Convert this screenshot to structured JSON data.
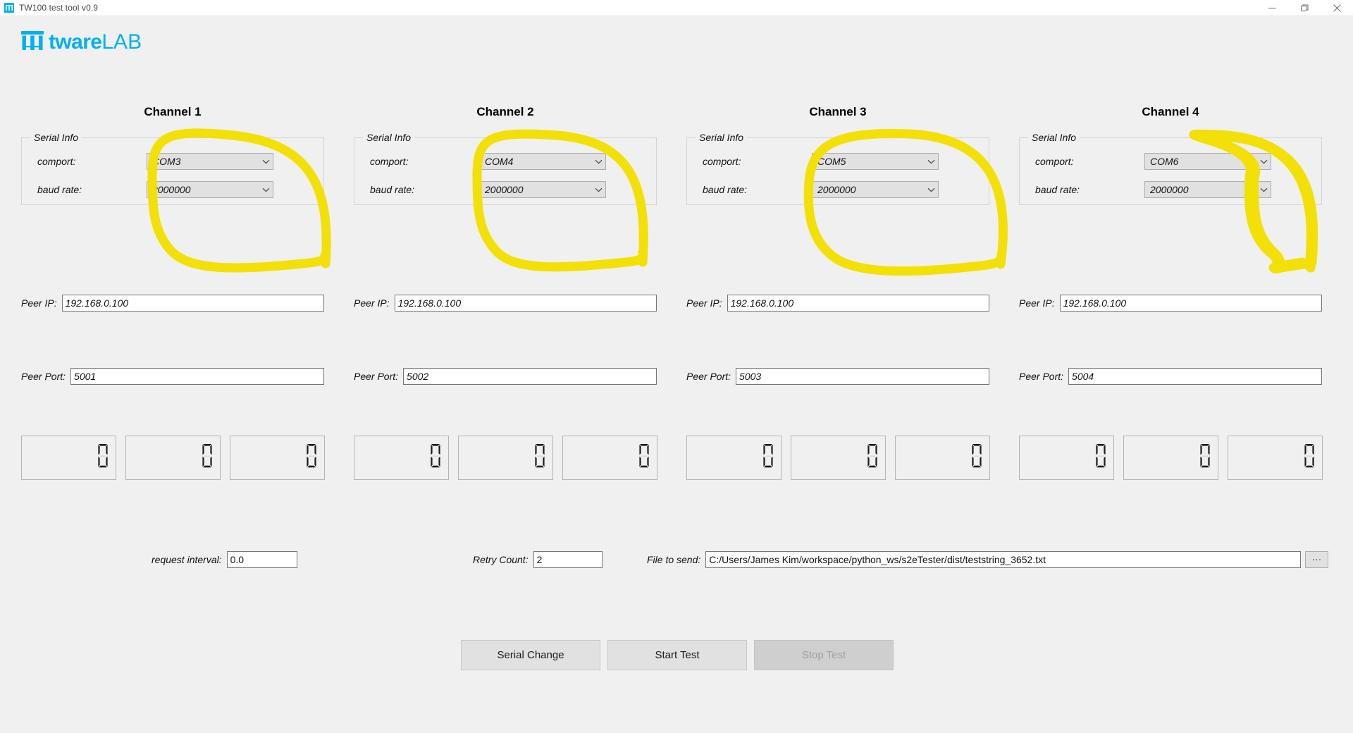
{
  "window": {
    "title": "TW100 test tool v0.9",
    "icon": "app-logo-icon",
    "minimize": "—",
    "maximize": "❐",
    "close": "✕"
  },
  "brand": {
    "mark": "tw-monogram-icon",
    "name": "tware",
    "suffix": "LAB",
    "color": "#00b0ef"
  },
  "channels": [
    {
      "title": "Channel 1",
      "serial_group_label": "Serial Info",
      "comport_label": "comport:",
      "comport_value": "COM3",
      "baud_label": "baud rate:",
      "baud_value": "2000000",
      "peer_ip_label": "Peer IP:",
      "peer_ip_value": "192.168.0.100",
      "peer_port_label": "Peer Port:",
      "peer_port_value": "5001",
      "counters": [
        "0",
        "0",
        "0"
      ]
    },
    {
      "title": "Channel 2",
      "serial_group_label": "Serial Info",
      "comport_label": "comport:",
      "comport_value": "COM4",
      "baud_label": "baud rate:",
      "baud_value": "2000000",
      "peer_ip_label": "Peer IP:",
      "peer_ip_value": "192.168.0.100",
      "peer_port_label": "Peer Port:",
      "peer_port_value": "5002",
      "counters": [
        "0",
        "0",
        "0"
      ]
    },
    {
      "title": "Channel 3",
      "serial_group_label": "Serial Info",
      "comport_label": "comport:",
      "comport_value": "COM5",
      "baud_label": "baud rate:",
      "baud_value": "2000000",
      "peer_ip_label": "Peer IP:",
      "peer_ip_value": "192.168.0.100",
      "peer_port_label": "Peer Port:",
      "peer_port_value": "5003",
      "counters": [
        "0",
        "0",
        "0"
      ]
    },
    {
      "title": "Channel 4",
      "serial_group_label": "Serial Info",
      "comport_label": "comport:",
      "comport_value": "COM6",
      "baud_label": "baud rate:",
      "baud_value": "2000000",
      "peer_ip_label": "Peer IP:",
      "peer_ip_value": "192.168.0.100",
      "peer_port_label": "Peer Port:",
      "peer_port_value": "5004",
      "counters": [
        "0",
        "0",
        "0"
      ]
    }
  ],
  "params": {
    "interval_label": "request interval:",
    "interval_value": "0.0",
    "retry_label": "Retry Count:",
    "retry_value": "2",
    "file_label": "File to send:",
    "file_value": "C:/Users/James Kim/workspace/python_ws/s2eTester/dist/teststring_3652.txt",
    "browse_label": "..."
  },
  "actions": {
    "serial_change": "Serial Change",
    "start_test": "Start Test",
    "stop_test": "Stop Test",
    "stop_test_disabled": true
  },
  "annotation": {
    "type": "handdrawn-circle",
    "color": "#f2e007",
    "count": 4,
    "targets": [
      "comport+baud of Channel 1",
      "comport+baud of Channel 2",
      "comport+baud of Channel 3",
      "comport+baud of Channel 4"
    ]
  }
}
